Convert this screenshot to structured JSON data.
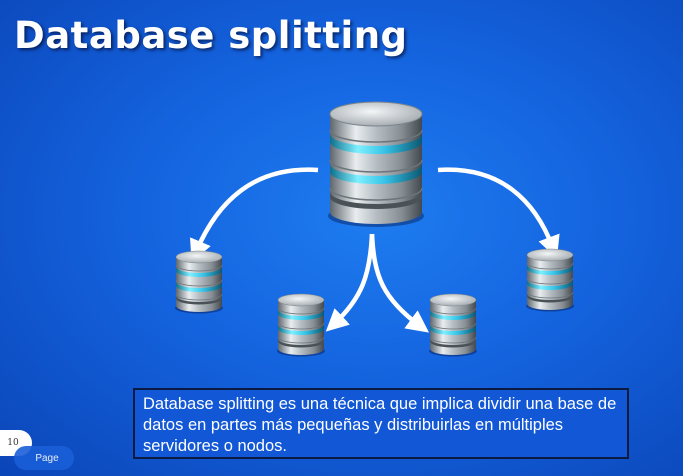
{
  "slide": {
    "title": "Database splitting",
    "description": "Database splitting es una técnica que implica dividir una base de datos en partes más pequeñas y distribuirlas en múltiples servidores o nodos.",
    "page_number": "10",
    "page_label": "Page"
  },
  "colors": {
    "background": "#1463de",
    "accent_ring": "#3fd0ee",
    "text": "#ffffff"
  },
  "icons": [
    "database-icon",
    "arrow-icon"
  ]
}
